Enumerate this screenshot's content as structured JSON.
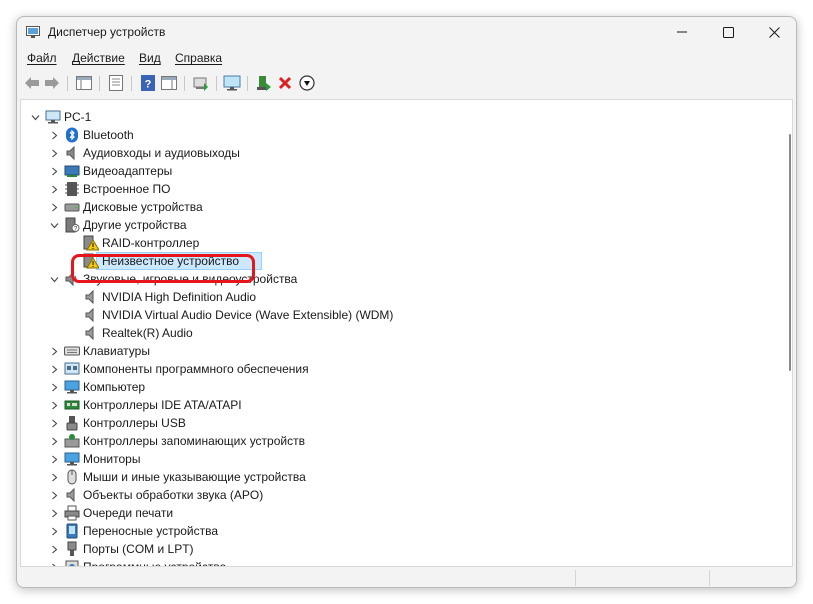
{
  "window": {
    "title": "Диспетчер устройств"
  },
  "menu": [
    "Файл",
    "Действие",
    "Вид",
    "Справка"
  ],
  "toolbar_icons": [
    "back-arrow-icon",
    "forward-arrow-icon",
    "properties-list-icon",
    "device-view-icon",
    "help-icon",
    "action-view-icon",
    "update-driver-icon",
    "scan-hardware-icon",
    "enable-device-icon",
    "uninstall-device-icon",
    "disable-device-icon"
  ],
  "tree": [
    {
      "label": "PC-1",
      "level": 0,
      "expanded": true,
      "icon": "computer-icon"
    },
    {
      "label": "Bluetooth",
      "level": 1,
      "expanded": false,
      "icon": "bluetooth-icon"
    },
    {
      "label": "Аудиовходы и аудиовыходы",
      "level": 1,
      "expanded": false,
      "icon": "audio-io-icon"
    },
    {
      "label": "Видеоадаптеры",
      "level": 1,
      "expanded": false,
      "icon": "display-adapter-icon"
    },
    {
      "label": "Встроенное ПО",
      "level": 1,
      "expanded": false,
      "icon": "firmware-icon"
    },
    {
      "label": "Дисковые устройства",
      "level": 1,
      "expanded": false,
      "icon": "disk-drive-icon"
    },
    {
      "label": "Другие устройства",
      "level": 1,
      "expanded": true,
      "icon": "other-devices-icon"
    },
    {
      "label": "RAID-контроллер",
      "level": 2,
      "icon": "warning-device-icon"
    },
    {
      "label": "Неизвестное устройство",
      "level": 2,
      "icon": "warning-device-icon",
      "selected": true
    },
    {
      "label": "Звуковые, игровые и видеоустройства",
      "level": 1,
      "expanded": true,
      "icon": "sound-video-icon"
    },
    {
      "label": "NVIDIA High Definition Audio",
      "level": 2,
      "icon": "speaker-icon"
    },
    {
      "label": "NVIDIA Virtual Audio Device (Wave Extensible) (WDM)",
      "level": 2,
      "icon": "speaker-icon"
    },
    {
      "label": "Realtek(R) Audio",
      "level": 2,
      "icon": "speaker-icon"
    },
    {
      "label": "Клавиатуры",
      "level": 1,
      "expanded": false,
      "icon": "keyboard-icon"
    },
    {
      "label": "Компоненты программного обеспечения",
      "level": 1,
      "expanded": false,
      "icon": "software-component-icon"
    },
    {
      "label": "Компьютер",
      "level": 1,
      "expanded": false,
      "icon": "monitor-icon"
    },
    {
      "label": "Контроллеры IDE ATA/ATAPI",
      "level": 1,
      "expanded": false,
      "icon": "ide-controller-icon"
    },
    {
      "label": "Контроллеры USB",
      "level": 1,
      "expanded": false,
      "icon": "usb-icon"
    },
    {
      "label": "Контроллеры запоминающих устройств",
      "level": 1,
      "expanded": false,
      "icon": "storage-controller-icon"
    },
    {
      "label": "Мониторы",
      "level": 1,
      "expanded": false,
      "icon": "monitor-icon"
    },
    {
      "label": "Мыши и иные указывающие устройства",
      "level": 1,
      "expanded": false,
      "icon": "mouse-icon"
    },
    {
      "label": "Объекты обработки звука (APO)",
      "level": 1,
      "expanded": false,
      "icon": "speaker-icon"
    },
    {
      "label": "Очереди печати",
      "level": 1,
      "expanded": false,
      "icon": "printer-icon"
    },
    {
      "label": "Переносные устройства",
      "level": 1,
      "expanded": false,
      "icon": "portable-device-icon"
    },
    {
      "label": "Порты (COM и LPT)",
      "level": 1,
      "expanded": false,
      "icon": "port-icon"
    },
    {
      "label": "Программные устройства",
      "level": 1,
      "expanded": false,
      "icon": "software-device-icon"
    }
  ],
  "colors": {
    "highlight_ring": "#e8141b",
    "selection": "#cce8ff",
    "warning": "#f2c811"
  }
}
